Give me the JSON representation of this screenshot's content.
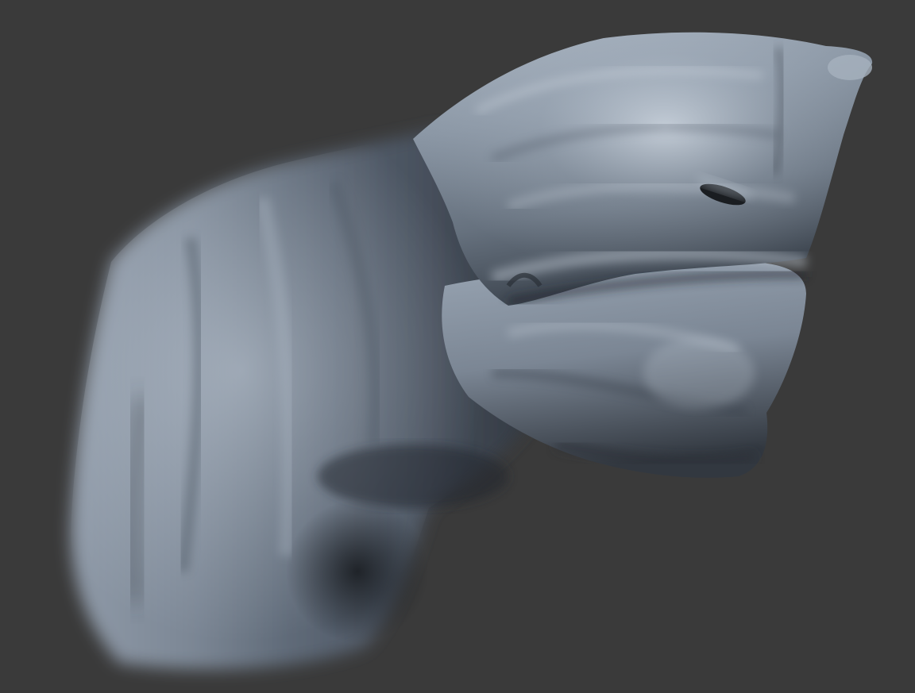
{
  "scene": {
    "background_color": "#3a3a3a",
    "material": {
      "base_color": "#6c7888",
      "highlight_color": "#cfd8e4",
      "shadow_color": "#1f2329"
    },
    "subject": "sculpted-creature-head"
  }
}
